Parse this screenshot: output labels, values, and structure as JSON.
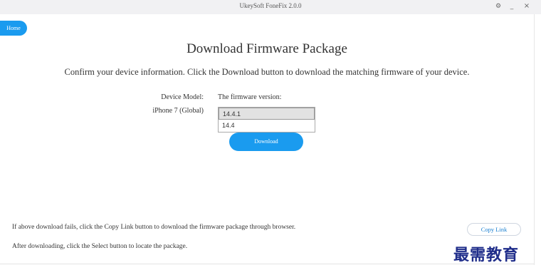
{
  "window": {
    "title": "UkeySoft FoneFix 2.0.0",
    "controls": {
      "settings_icon": "gear-icon",
      "minimize": "_",
      "close": "×"
    }
  },
  "nav": {
    "home_label": "Home"
  },
  "main": {
    "heading": "Download Firmware Package",
    "subheading": "Confirm your device information. Click the Download button to download the matching firmware of your device.",
    "device_model_label": "Device Model:",
    "device_model_value": "iPhone 7 (Global)",
    "firmware_label": "The firmware version:",
    "firmware_options": [
      {
        "label": "14.4.1",
        "selected": true
      },
      {
        "label": "14.4",
        "selected": false
      }
    ],
    "download_label": "Download"
  },
  "footer": {
    "note_copy": "If above download fails, click the Copy Link button to download the firmware package through browser.",
    "note_select": "After downloading, click the Select button to locate the package.",
    "copy_link_label": "Copy Link"
  },
  "watermark": {
    "text": "最需教育"
  },
  "colors": {
    "accent": "#1a9bef",
    "titlebar": "#f1f1f3",
    "text": "#333333"
  }
}
